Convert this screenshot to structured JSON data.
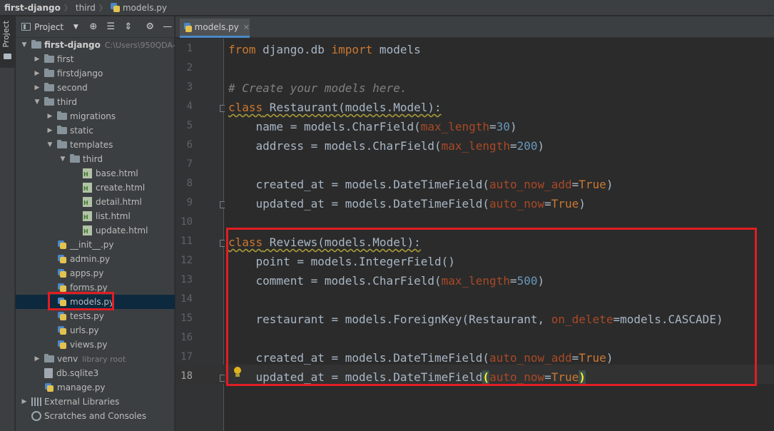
{
  "breadcrumb": [
    "first-django",
    "third",
    "models.py"
  ],
  "project_panel": {
    "title": "Project",
    "tool_tab": "Project",
    "icons": [
      "dropdown-icon",
      "locate-icon",
      "expand-all-icon",
      "collapse-all-icon",
      "gear-icon",
      "minimize-icon"
    ]
  },
  "tree": [
    {
      "label": "first-django",
      "hint": "C:\\Users\\950QDA-",
      "type": "root",
      "expanded": true,
      "depth": 0
    },
    {
      "label": "first",
      "type": "folder",
      "expanded": false,
      "depth": 1
    },
    {
      "label": "firstdjango",
      "type": "folder",
      "expanded": false,
      "depth": 1
    },
    {
      "label": "second",
      "type": "folder",
      "expanded": false,
      "depth": 1
    },
    {
      "label": "third",
      "type": "folder",
      "expanded": true,
      "depth": 1
    },
    {
      "label": "migrations",
      "type": "folder",
      "expanded": false,
      "depth": 2
    },
    {
      "label": "static",
      "type": "folder",
      "expanded": false,
      "depth": 2
    },
    {
      "label": "templates",
      "type": "folder",
      "expanded": true,
      "depth": 2
    },
    {
      "label": "third",
      "type": "folder",
      "expanded": true,
      "depth": 3
    },
    {
      "label": "base.html",
      "type": "html",
      "depth": 4
    },
    {
      "label": "create.html",
      "type": "html",
      "depth": 4
    },
    {
      "label": "detail.html",
      "type": "html",
      "depth": 4
    },
    {
      "label": "list.html",
      "type": "html",
      "depth": 4
    },
    {
      "label": "update.html",
      "type": "html",
      "depth": 4
    },
    {
      "label": "__init__.py",
      "type": "py",
      "depth": 2
    },
    {
      "label": "admin.py",
      "type": "py",
      "depth": 2
    },
    {
      "label": "apps.py",
      "type": "py",
      "depth": 2
    },
    {
      "label": "forms.py",
      "type": "py",
      "depth": 2
    },
    {
      "label": "models.py",
      "type": "py",
      "depth": 2,
      "selected": true
    },
    {
      "label": "tests.py",
      "type": "py",
      "depth": 2
    },
    {
      "label": "urls.py",
      "type": "py",
      "depth": 2
    },
    {
      "label": "views.py",
      "type": "py",
      "depth": 2
    },
    {
      "label": "venv",
      "hint": "library root",
      "type": "folder",
      "expanded": false,
      "depth": 1
    },
    {
      "label": "db.sqlite3",
      "type": "db",
      "depth": 1
    },
    {
      "label": "manage.py",
      "type": "py",
      "depth": 1
    },
    {
      "label": "External Libraries",
      "type": "lib",
      "expanded": false,
      "depth": 0
    },
    {
      "label": "Scratches and Consoles",
      "type": "scratch",
      "depth": 0
    }
  ],
  "editor": {
    "tab_label": "models.py",
    "current_line": 18,
    "lines": [
      {
        "n": "1",
        "html": "<span class=\"kw\">from</span> django.db <span class=\"kw\">import</span> models"
      },
      {
        "n": "2",
        "html": ""
      },
      {
        "n": "3",
        "html": "<span class=\"cm\"># Create your models here.</span>"
      },
      {
        "n": "4",
        "html": "<span class=\"wavy\"><span class=\"kw\">class</span> Restaurant(models.Model):</span>"
      },
      {
        "n": "5",
        "html": "    name = models.CharField(<span class=\"pn\">max_length</span>=<span class=\"nu\">30</span>)"
      },
      {
        "n": "6",
        "html": "    address = models.CharField(<span class=\"pn\">max_length</span>=<span class=\"nu\">200</span>)"
      },
      {
        "n": "7",
        "html": ""
      },
      {
        "n": "8",
        "html": "    created_at = models.DateTimeField(<span class=\"pn\">auto_now_add</span>=<span class=\"kw\">True</span>)"
      },
      {
        "n": "9",
        "html": "    updated_at = models.DateTimeField(<span class=\"pn\">auto_now</span>=<span class=\"kw\">True</span>)"
      },
      {
        "n": "10",
        "html": ""
      },
      {
        "n": "11",
        "html": "<span class=\"wavy\"><span class=\"kw\">class</span> Reviews(models.Model):</span>"
      },
      {
        "n": "12",
        "html": "    point = models.IntegerField()"
      },
      {
        "n": "13",
        "html": "    comment = models.CharField(<span class=\"pn\">max_length</span>=<span class=\"nu\">500</span>)"
      },
      {
        "n": "14",
        "html": ""
      },
      {
        "n": "15",
        "html": "    restaurant = models.ForeignKey(Restaurant, <span class=\"pn\">on_delete</span>=models.CASCADE)"
      },
      {
        "n": "16",
        "html": ""
      },
      {
        "n": "17",
        "html": "    created_at = models.DateTimeField(<span class=\"pn\">auto_now_add</span>=<span class=\"kw\">True</span>)"
      },
      {
        "n": "18",
        "html": "    updated_at = models.DateTimeField<span class=\"brk\">(</span><span class=\"pn\">auto_now</span>=<span class=\"kw\">True</span><span class=\"brk\">)</span>"
      }
    ]
  },
  "colors": {
    "highlight_box": "#e11d24",
    "keyword": "#cc7832",
    "param": "#aa4926",
    "number": "#6897bb",
    "comment": "#808080"
  }
}
